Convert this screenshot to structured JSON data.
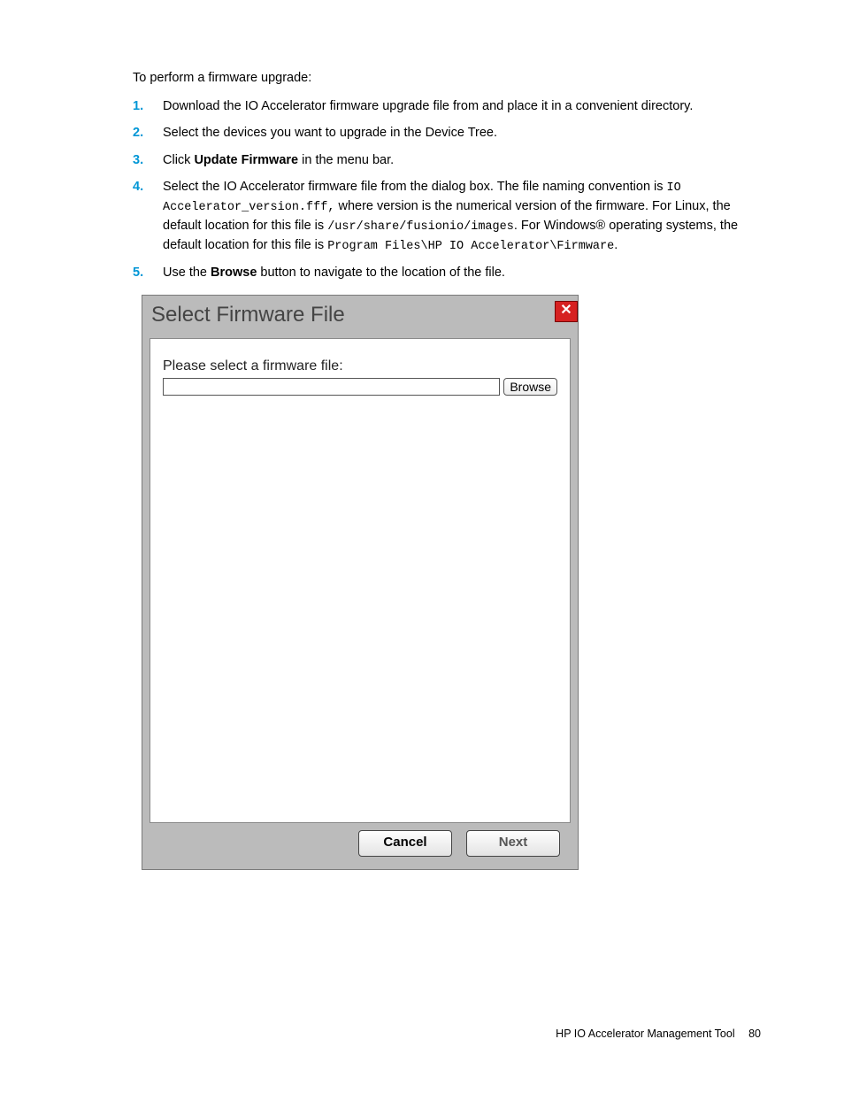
{
  "intro": "To perform a firmware upgrade:",
  "steps": {
    "n1": "1.",
    "s1": "Download the IO Accelerator firmware upgrade file from and place it in a convenient directory.",
    "n2": "2.",
    "s2": "Select the devices you want to upgrade in the Device Tree.",
    "n3": "3.",
    "s3a": "Click ",
    "s3b": "Update Firmware",
    "s3c": " in the menu bar.",
    "n4": "4.",
    "s4a": "Select the IO Accelerator firmware file from the dialog box. The file naming convention is ",
    "s4b": "IO Accelerator_version.fff,",
    "s4c": " where version is the numerical version of the firmware. For Linux, the default location for this file is ",
    "s4d": "/usr/share/fusionio/images",
    "s4e": ". For Windows® operating systems, the default location for this file is ",
    "s4f": "Program Files\\HP IO Accelerator\\Firmware",
    "s4g": ".",
    "n5": "5.",
    "s5a": "Use the ",
    "s5b": "Browse",
    "s5c": " button to navigate to the location of the file."
  },
  "dialog": {
    "title": "Select Firmware File",
    "close": "✕",
    "prompt": "Please select a firmware file:",
    "browse": "Browse",
    "cancel": "Cancel",
    "next": "Next"
  },
  "footer": {
    "label": "HP IO Accelerator Management Tool",
    "page": "80"
  }
}
